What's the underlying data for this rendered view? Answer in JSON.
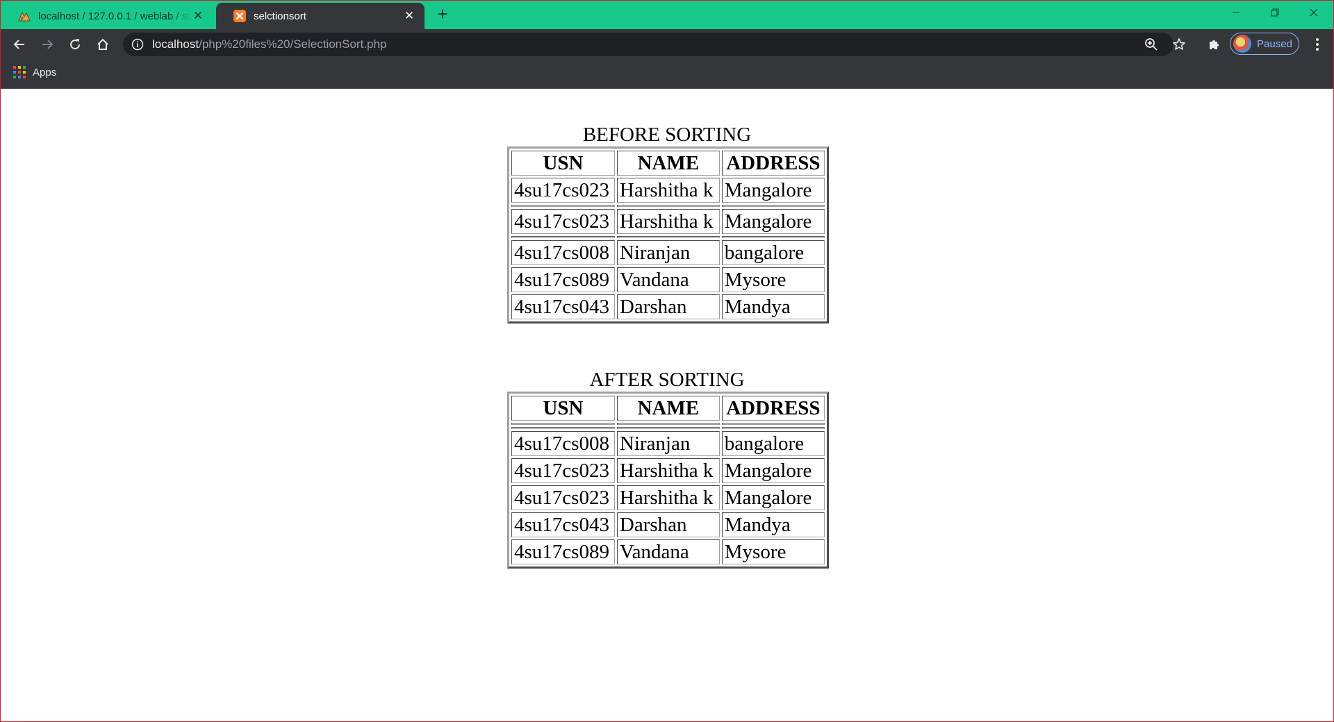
{
  "browser": {
    "tabs": [
      {
        "title": "localhost / 127.0.0.1 / weblab / st",
        "active": false,
        "favicon": "phpmyadmin-icon"
      },
      {
        "title": "selctionsort",
        "active": true,
        "favicon": "xampp-icon"
      }
    ],
    "url": {
      "host": "localhost",
      "path": "/php%20files%20/SelectionSort.php"
    },
    "profile_label": "Paused",
    "bookmarks": [
      {
        "label": "Apps"
      }
    ],
    "colors": {
      "tabstrip": "#17c98b",
      "toolbar": "#35363a",
      "omnibox": "#202124",
      "profile_accent": "#8ab4f8"
    }
  },
  "page": {
    "before": {
      "caption": "BEFORE SORTING",
      "headers": [
        "USN",
        "NAME",
        "ADDRESS"
      ],
      "rows": [
        [
          "4su17cs023",
          "Harshitha k",
          "Mangalore"
        ],
        [
          "",
          "",
          ""
        ],
        [
          "4su17cs023",
          "Harshitha k",
          "Mangalore"
        ],
        [
          "",
          "",
          ""
        ],
        [
          "4su17cs008",
          "Niranjan",
          "bangalore"
        ],
        [
          "4su17cs089",
          "Vandana",
          "Mysore"
        ],
        [
          "4su17cs043",
          "Darshan",
          "Mandya"
        ]
      ]
    },
    "after": {
      "caption": "AFTER SORTING",
      "headers": [
        "USN",
        "NAME",
        "ADDRESS"
      ],
      "rows": [
        [
          "",
          "",
          ""
        ],
        [
          "",
          "",
          ""
        ],
        [
          "4su17cs008",
          "Niranjan",
          "bangalore"
        ],
        [
          "4su17cs023",
          "Harshitha k",
          "Mangalore"
        ],
        [
          "4su17cs023",
          "Harshitha k",
          "Mangalore"
        ],
        [
          "4su17cs043",
          "Darshan",
          "Mandya"
        ],
        [
          "4su17cs089",
          "Vandana",
          "Mysore"
        ]
      ]
    }
  }
}
